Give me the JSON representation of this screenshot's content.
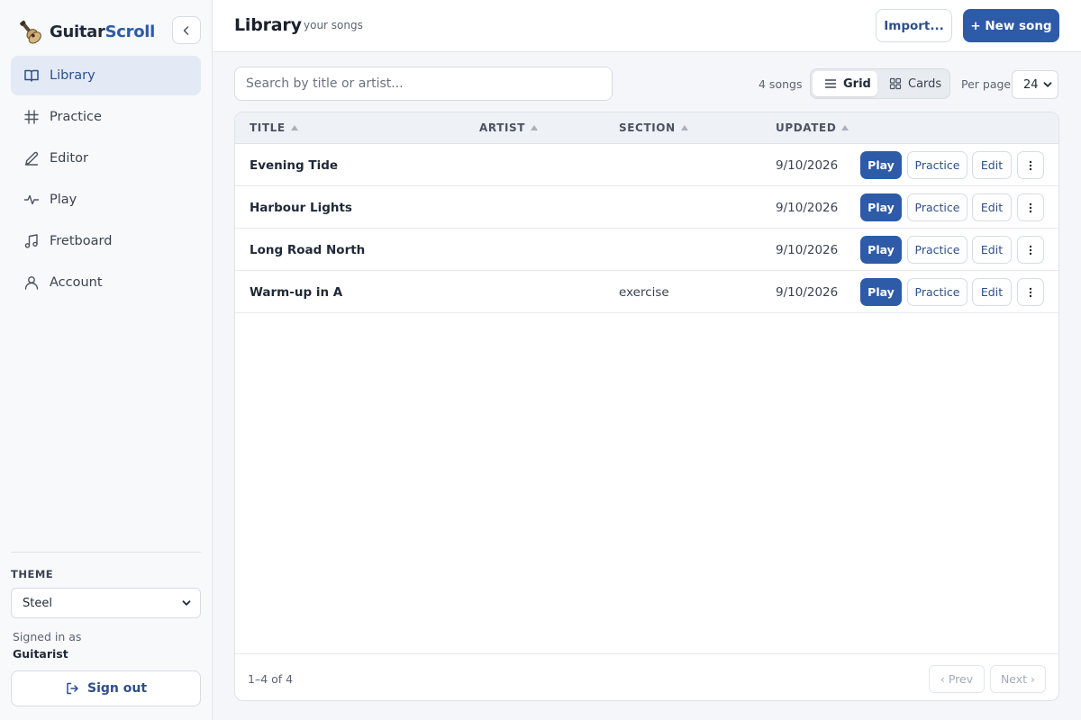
{
  "brand": {
    "name_part1": "Guitar",
    "name_part2": "Scroll"
  },
  "sidebar": {
    "items": [
      {
        "label": "Library",
        "icon": "book-icon",
        "active": true
      },
      {
        "label": "Practice",
        "icon": "hash-icon"
      },
      {
        "label": "Editor",
        "icon": "pen-icon"
      },
      {
        "label": "Play",
        "icon": "pulse-icon"
      },
      {
        "label": "Fretboard",
        "icon": "music-note-icon"
      },
      {
        "label": "Account",
        "icon": "user-icon"
      }
    ],
    "theme_label": "THEME",
    "theme_value": "Steel",
    "signed_in_label": "Signed in as",
    "signed_in_user": "Guitarist",
    "sign_out_label": "Sign out"
  },
  "header": {
    "title": "Library",
    "subtitle": "your songs",
    "import_label": "Import...",
    "new_song_label": "+ New song"
  },
  "toolbar": {
    "search_placeholder": "Search by title or artist...",
    "count": "4 songs",
    "view_grid": "Grid",
    "view_cards": "Cards",
    "per_page_label": "Per page",
    "per_page_value": "24"
  },
  "table": {
    "columns": [
      "TITLE",
      "ARTIST",
      "SECTION",
      "UPDATED"
    ],
    "rows": [
      {
        "title": "Evening Tide",
        "artist": "",
        "section": "",
        "updated": "9/10/2026"
      },
      {
        "title": "Harbour Lights",
        "artist": "",
        "section": "",
        "updated": "9/10/2026"
      },
      {
        "title": "Long Road North",
        "artist": "",
        "section": "",
        "updated": "9/10/2026"
      },
      {
        "title": "Warm-up in A",
        "artist": "",
        "section": "exercise",
        "updated": "9/10/2026"
      }
    ],
    "actions": {
      "play": "Play",
      "practice": "Practice",
      "edit": "Edit"
    },
    "range": "1–4 of 4",
    "prev": "‹ Prev",
    "next": "Next ›"
  },
  "colors": {
    "accent": "#2d5ba8",
    "active_bg": "#e3eaf6"
  }
}
